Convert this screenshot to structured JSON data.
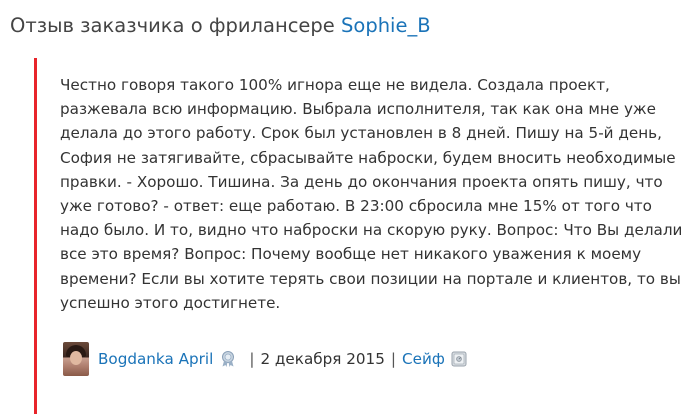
{
  "header": {
    "title_prefix": "Отзыв заказчика о фрилансере",
    "freelancer_name": "Sophie_B"
  },
  "review": {
    "lines": [
      "Честно говоря такого 100% игнора еще не видела. Создала проект,",
      "разжевала всю информацию. Выбрала исполнителя, так как она мне уже",
      "делала до этого работу. Срок был установлен в 8 дней. Пишу на 5-й день,",
      "София не затягивайте, сбрасывайте наброски, будем вносить необходимые",
      "правки. - Хорошо. Тишина. За день до окончания проекта опять пишу, что",
      "уже готово? - ответ: еще работаю. В 23:00 сбросила мне 15% от того что",
      "надо было. И то, видно что наброски на скорую руку. Вопрос: Что Вы делали",
      "все это время? Вопрос: Почему вообще нет никакого уважения к моему",
      "времени? Если вы хотите терять свои позиции на портале и клиентов, то вы",
      "успешно этого достигнете."
    ]
  },
  "footer": {
    "author_name": "Bogdanka April",
    "separator": "|",
    "date": "2 декабря 2015",
    "payment_type": "Сейф",
    "icons": {
      "avatar": "user-avatar",
      "author_badge": "award-badge-icon",
      "safe": "safe-icon"
    }
  },
  "colors": {
    "link": "#1a73b8",
    "quote_bar": "#e8242a",
    "text": "#333333"
  }
}
